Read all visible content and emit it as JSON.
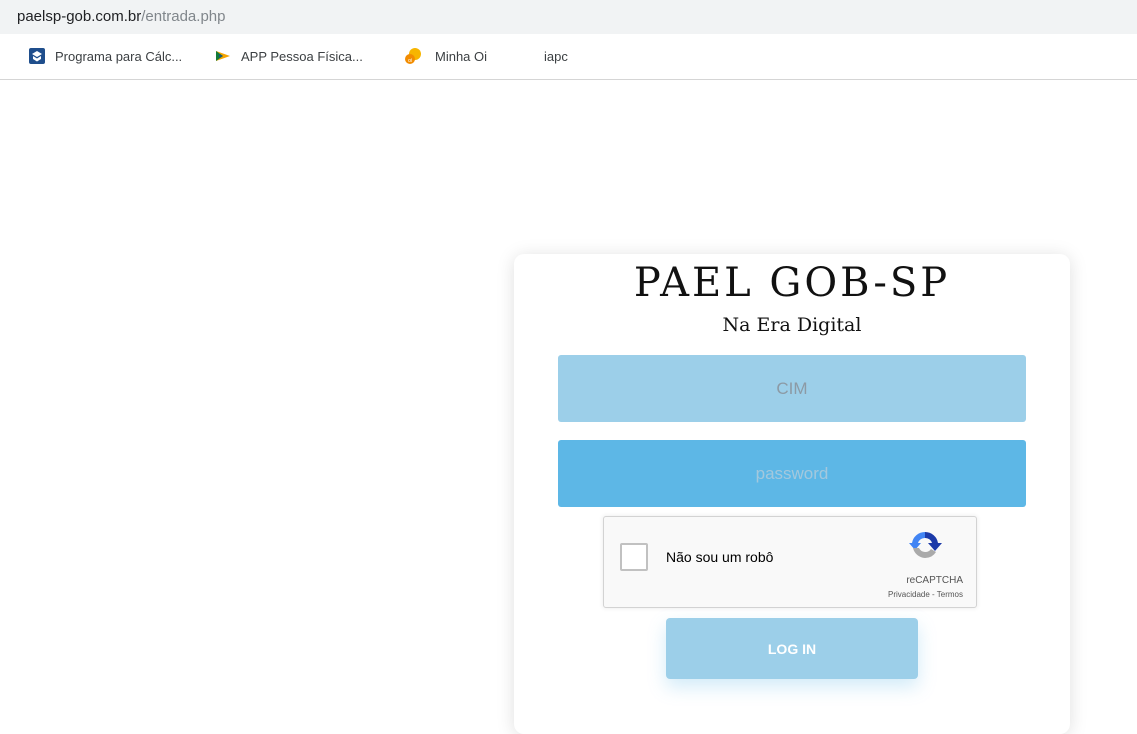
{
  "browser": {
    "url_host": "paelsp-gob.com.br",
    "url_path": "/entrada.php",
    "bookmarks": [
      {
        "label": "Programa para Cálc...",
        "icon": "govbr-icon"
      },
      {
        "label": "APP Pessoa Física...",
        "icon": "receita-arrow-icon"
      },
      {
        "label": "Minha Oi",
        "icon": "oi-icon"
      },
      {
        "label": "iapc",
        "icon": ""
      }
    ]
  },
  "login": {
    "title": "PAEL GOB-SP",
    "subtitle": "Na Era Digital",
    "cim_placeholder": "CIM",
    "password_placeholder": "password",
    "recaptcha": {
      "label": "Não sou um robô",
      "brand": "reCAPTCHA",
      "privacy": "Privacidade",
      "separator": " - ",
      "terms": "Termos"
    },
    "button_label": "LOG IN"
  },
  "colors": {
    "cim_bg": "#9ccfe9",
    "password_bg": "#5db7e6",
    "button_bg": "#9ccfe9"
  }
}
